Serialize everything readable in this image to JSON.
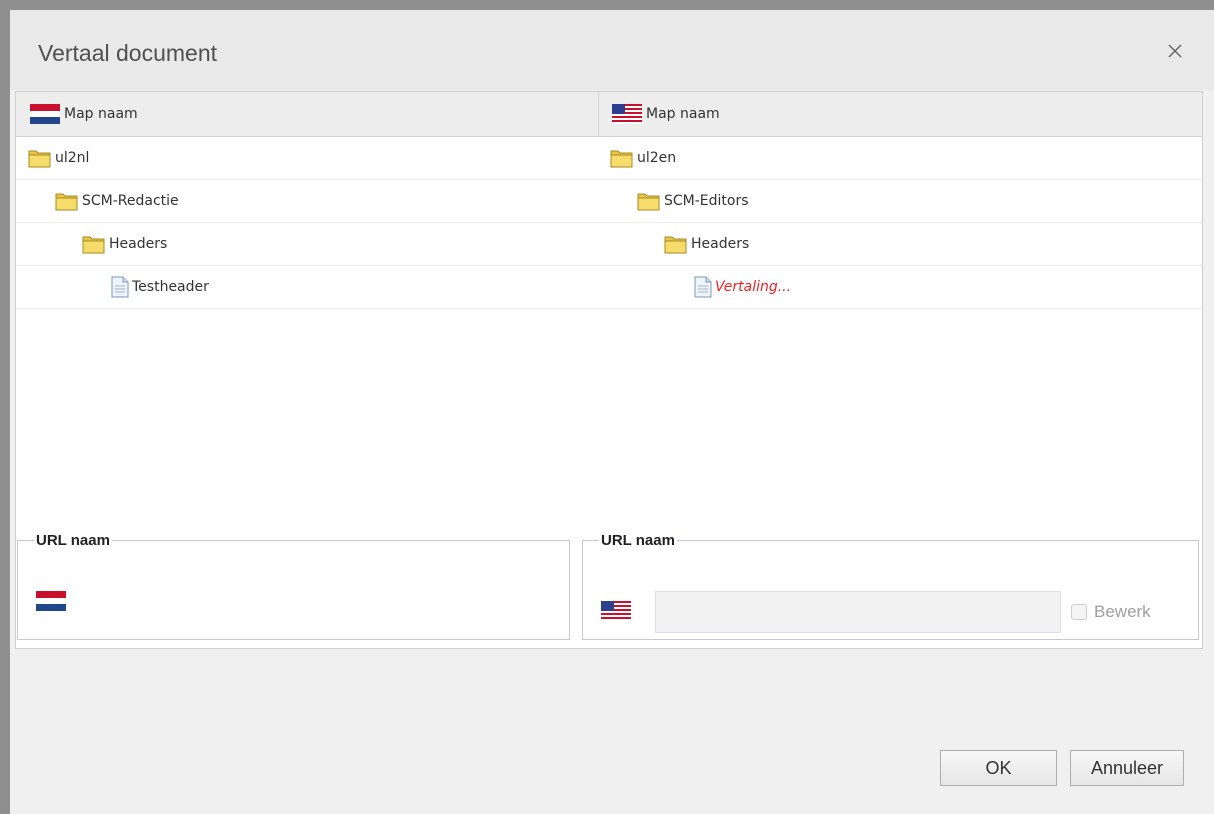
{
  "dialog": {
    "title": "Vertaal document",
    "close_icon": "close-icon"
  },
  "grid": {
    "headers": {
      "left": {
        "flag": "flag-nl-icon",
        "label": "Map naam"
      },
      "right": {
        "flag": "flag-us-icon",
        "label": "Map naam"
      }
    },
    "rows": [
      {
        "left": {
          "icon": "folder-icon",
          "label": "ul2nl"
        },
        "right": {
          "icon": "folder-icon",
          "label": "ul2en"
        }
      },
      {
        "left": {
          "icon": "folder-icon",
          "label": "SCM-Redactie"
        },
        "right": {
          "icon": "folder-icon",
          "label": "SCM-Editors"
        }
      },
      {
        "left": {
          "icon": "folder-icon",
          "label": "Headers"
        },
        "right": {
          "icon": "folder-icon",
          "label": "Headers"
        }
      },
      {
        "left": {
          "icon": "document-icon",
          "label": "Testheader"
        },
        "right": {
          "icon": "document-icon",
          "label": "Vertaling...",
          "color": "#ee2222"
        }
      }
    ]
  },
  "url_section": {
    "left": {
      "legend": "URL naam",
      "flag": "flag-nl-icon"
    },
    "right": {
      "legend": "URL naam",
      "flag": "flag-us-icon",
      "input_value": "",
      "checkbox_label": "Bewerk",
      "checkbox_checked": false,
      "checkbox_disabled": true
    }
  },
  "buttons": {
    "ok": "OK",
    "cancel": "Annuleer"
  }
}
